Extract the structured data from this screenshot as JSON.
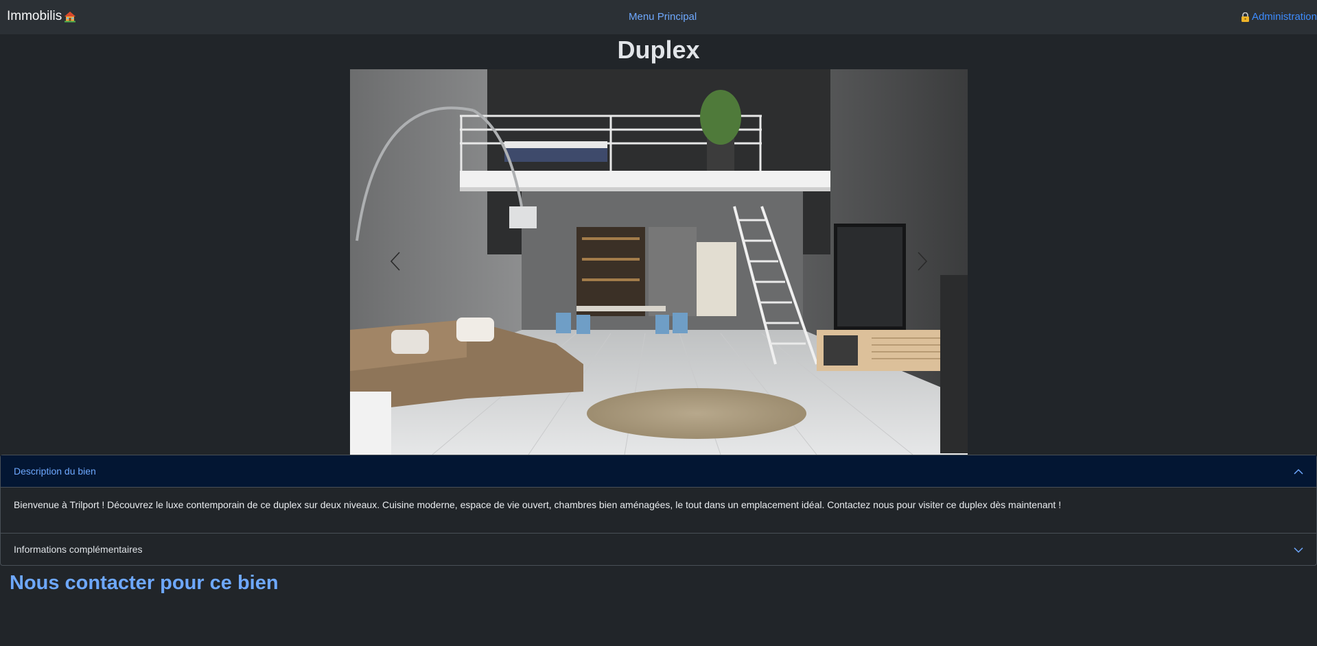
{
  "navbar": {
    "brand": "Immobilis",
    "center_link": "Menu Principal",
    "admin_link": "Administration"
  },
  "listing": {
    "title": "Duplex"
  },
  "accordion": {
    "description_header": "Description du bien",
    "description_body": "Bienvenue à Trilport ! Découvrez le luxe contemporain de ce duplex sur deux niveaux. Cuisine moderne, espace de vie ouvert, chambres bien aménagées, le tout dans un emplacement idéal. Contactez nous pour visiter ce duplex dès maintenant !",
    "info_header": "Informations complémentaires"
  },
  "contact": {
    "title": "Nous contacter pour ce bien"
  },
  "colors": {
    "background": "#212529",
    "navbar": "#2b3035",
    "link": "#6ea8fe",
    "accordion_active": "#031633"
  },
  "icons": {
    "brand": "house-icon",
    "admin": "lock-icon",
    "prev": "chevron-left-icon",
    "next": "chevron-right-icon"
  }
}
